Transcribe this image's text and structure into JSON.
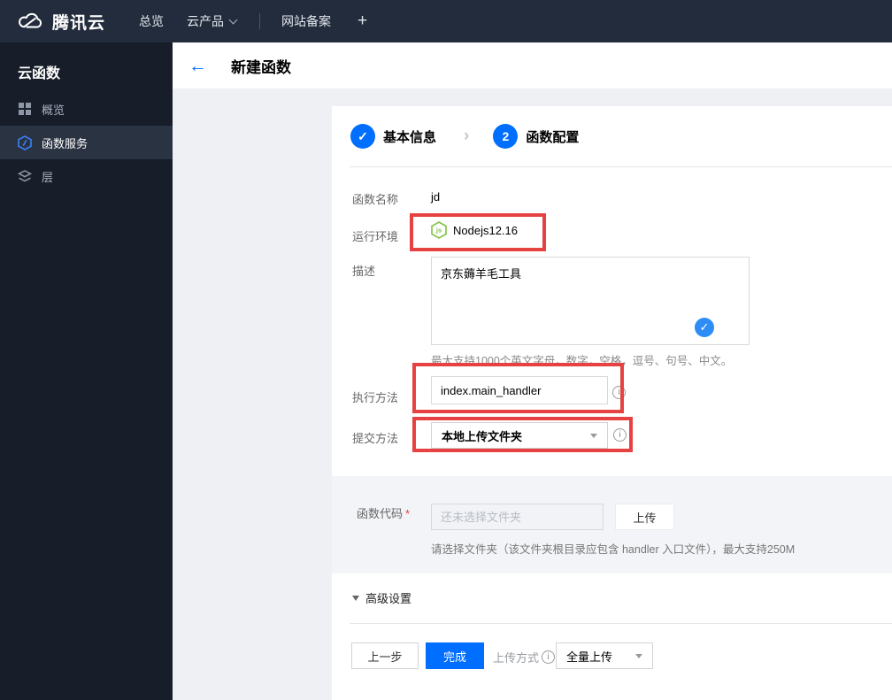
{
  "topbar": {
    "brand": "腾讯云",
    "overview": "总览",
    "products": "云产品",
    "beian": "网站备案",
    "plus": "+"
  },
  "sidebar": {
    "title": "云函数",
    "items": [
      {
        "label": "概览",
        "icon": "grid-icon"
      },
      {
        "label": "函数服务",
        "icon": "function-hexagon-icon"
      },
      {
        "label": "层",
        "icon": "layers-icon"
      }
    ]
  },
  "header": {
    "title": "新建函数",
    "back_icon": "←"
  },
  "steps": {
    "step1_mark": "✓",
    "step1_label": "基本信息",
    "step2_num": "2",
    "step2_label": "函数配置"
  },
  "form": {
    "name_label": "函数名称",
    "name_value": "jd",
    "runtime_label": "运行环境",
    "runtime_value": "Nodejs12.16",
    "desc_label": "描述",
    "desc_value": "京东薅羊毛工具",
    "desc_check": "✓",
    "desc_hint": "最大支持1000个英文字母，数字，空格，逗号、句号、中文。",
    "handler_label": "执行方法",
    "handler_value": "index.main_handler",
    "submit_label": "提交方法",
    "submit_value": "本地上传文件夹"
  },
  "code_section": {
    "label": "函数代码",
    "required_mark": "*",
    "placeholder": "还未选择文件夹",
    "upload_button": "上传",
    "hint": "请选择文件夹（该文件夹根目录应包含 handler 入口文件），最大支持250M"
  },
  "advanced_label": "高级设置",
  "footer": {
    "prev_button": "上一步",
    "finish_button": "完成",
    "upload_mode_label": "上传方式",
    "upload_mode_value": "全量上传"
  },
  "colors": {
    "primary_blue": "#006eff",
    "check_bubble_blue": "#2d8df5",
    "annotation_red": "#e64242",
    "nodejs_green": "#7fc241",
    "topbar_bg": "#222c3c",
    "sidebar_bg": "#171d29",
    "page_bg": "#eef0f3",
    "section_bg": "#f2f4f7"
  }
}
